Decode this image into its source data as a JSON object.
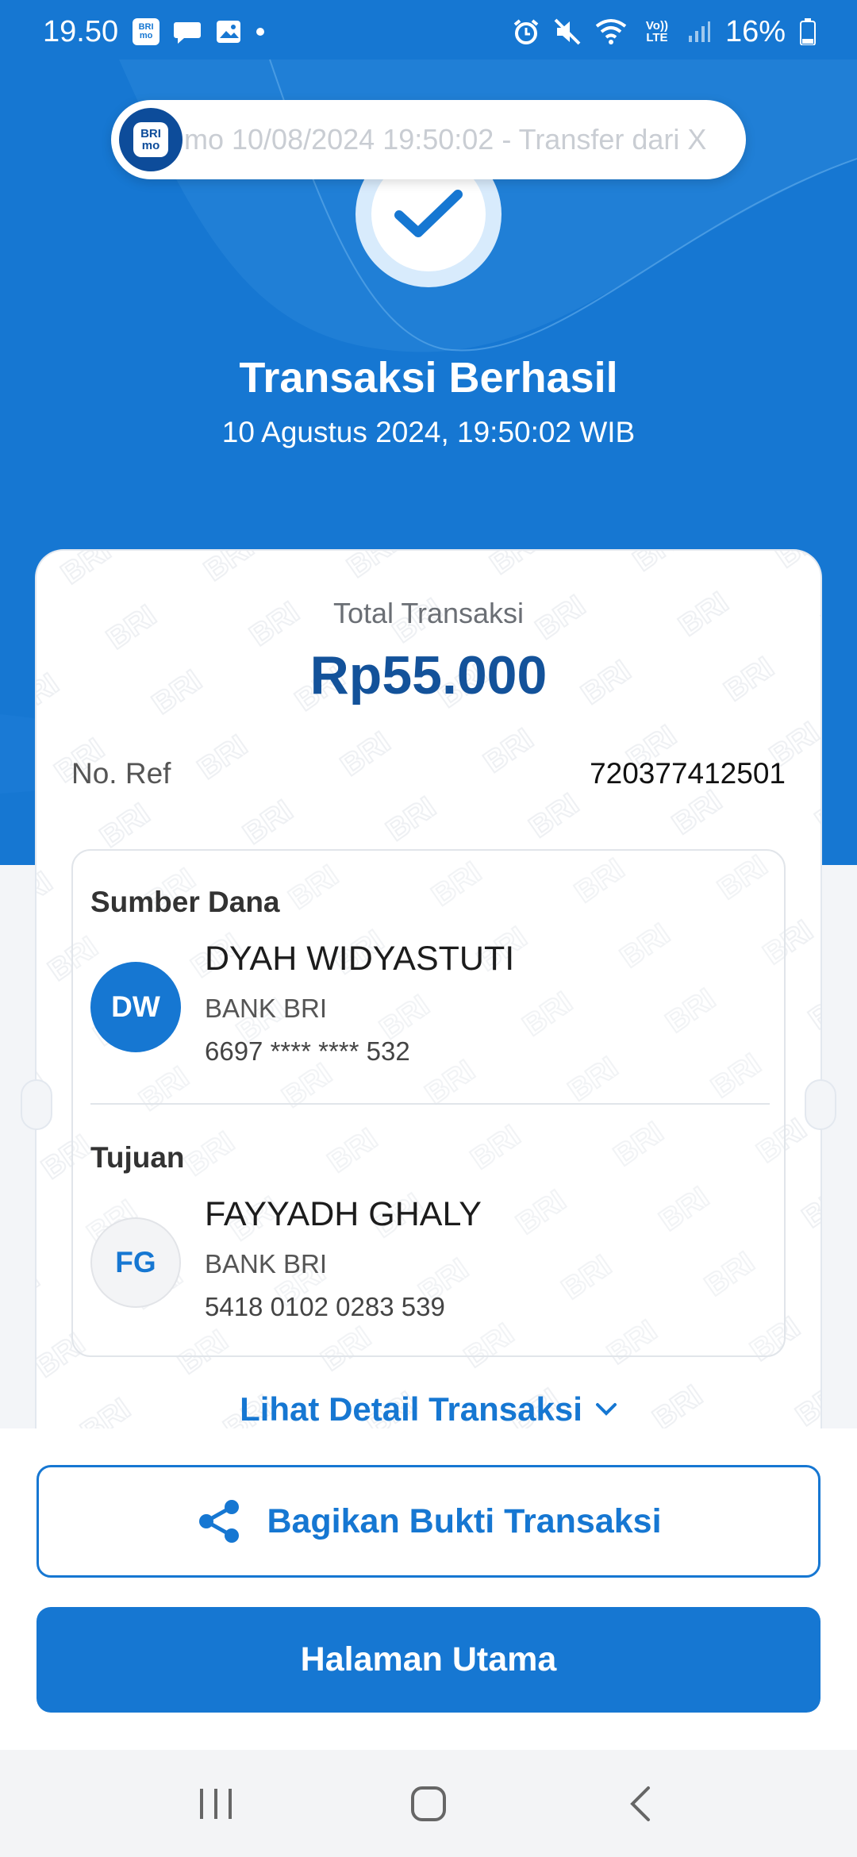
{
  "status_bar": {
    "time": "19.50",
    "app_icon_text": "BRI mo",
    "battery": "16%",
    "network": "Vo)) LTE"
  },
  "notification": {
    "text": "mo  10/08/2024 19:50:02 - Transfer dari X",
    "logo_text": "BRI mo"
  },
  "header": {
    "title": "Transaksi Berhasil",
    "datetime": "10 Agustus 2024, 19:50:02 WIB"
  },
  "receipt": {
    "total_label": "Total Transaksi",
    "total_amount": "Rp55.000",
    "ref_label": "No. Ref",
    "ref_value": "720377412501",
    "source": {
      "section_title": "Sumber Dana",
      "initials": "DW",
      "name": "DYAH WIDYASTUTI",
      "bank": "BANK BRI",
      "account": "6697 **** **** 532"
    },
    "destination": {
      "section_title": "Tujuan",
      "initials": "FG",
      "name": "FAYYADH GHALY",
      "bank": "BANK BRI",
      "account": "5418 0102 0283 539"
    },
    "detail_link": "Lihat Detail Transaksi",
    "watermark_text": "BRI"
  },
  "actions": {
    "share_label": "Bagikan Bukti Transaksi",
    "home_label": "Halaman Utama"
  },
  "colors": {
    "primary": "#1677d2",
    "dark_blue": "#13529a",
    "hero_bg": "#1677d2"
  },
  "icons": [
    "alarm-icon",
    "mute-icon",
    "wifi-icon",
    "signal-icon",
    "battery-icon",
    "chat-icon",
    "gallery-icon",
    "check-icon",
    "share-icon",
    "chevron-down-icon",
    "recent-apps-icon",
    "home-icon",
    "back-icon"
  ]
}
